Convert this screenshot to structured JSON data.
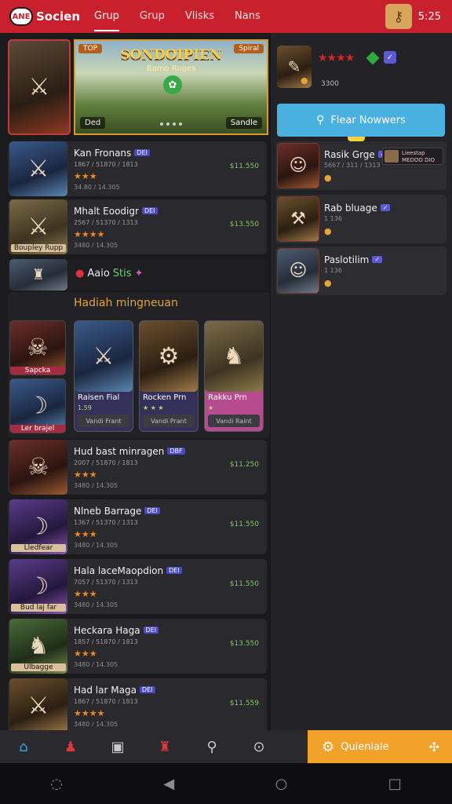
{
  "app": {
    "logo_mark": "ANE",
    "name": "Socien",
    "time": "5:25"
  },
  "tabs": [
    {
      "label": "Grup",
      "active": true
    },
    {
      "label": "Grup",
      "active": false
    },
    {
      "label": "Vlisks",
      "active": false
    },
    {
      "label": "Nans",
      "active": false
    }
  ],
  "banner": {
    "title": "SONDOIPIEN",
    "subtitle": "Bamo Ruges",
    "tag_left": "TOP",
    "tag_right": "Spiral",
    "label": "Ded",
    "button": "Sandle"
  },
  "games": [
    {
      "name": "Kan Fronans",
      "ver": "DEI",
      "meta": "1867 / 51870 / 1813",
      "stars": "★★★",
      "size": "34.80 / 14.305",
      "price": "$11.550",
      "art": "art-a",
      "caption": ""
    },
    {
      "name": "Mhalt Eoodigr",
      "ver": "DEI",
      "meta": "2567 / 51370 / 1313",
      "stars": "★★★★",
      "size": "3480 / 14.305",
      "price": "$13.550",
      "art": "art-c",
      "caption": "Boupley Rupp"
    },
    {
      "name": "Hud bast minragen",
      "ver": "DBF",
      "meta": "2007 / 51870 / 1813",
      "stars": "★★★",
      "size": "3480 / 14.305",
      "price": "$11.250",
      "art": "art-e",
      "caption": ""
    },
    {
      "name": "Nlneb Barrage",
      "ver": "DEI",
      "meta": "1367 / 51370 / 1313",
      "stars": "★★★",
      "size": "3480 / 14.305",
      "price": "$11.550",
      "art": "art-f",
      "caption": "Lledfear"
    },
    {
      "name": "Hala laceMaopdion",
      "ver": "DEI",
      "meta": "7057 / 51370 / 1313",
      "stars": "★★★",
      "size": "3480 / 14.305",
      "price": "$11.550",
      "art": "art-f",
      "caption": "Bud laj far"
    },
    {
      "name": "Heckara Haga",
      "ver": "DEI",
      "meta": "1857 / 51870 / 1813",
      "stars": "★★★",
      "size": "3480 / 14.305",
      "price": "$13.550",
      "art": "art-g",
      "caption": "Ulbagge"
    },
    {
      "name": "Had lar Maga",
      "ver": "DEI",
      "meta": "1867 / 51870 / 1813",
      "stars": "★★★★",
      "size": "3480 / 14.305",
      "price": "$11.559",
      "art": "art-h",
      "caption": ""
    }
  ],
  "online": {
    "label": "Aaio",
    "status": "Stis"
  },
  "section": {
    "title": "Hadiah mingneuan"
  },
  "side_thumbs": [
    {
      "caption": "Sapcka"
    },
    {
      "caption": "Ler brajel"
    }
  ],
  "promos": [
    {
      "title": "Raisen Fial",
      "sub": "1.59",
      "button": "Vandi Frant",
      "style": "purple"
    },
    {
      "title": "Rocken Prn",
      "sub": "★ ★ ★",
      "button": "Vandi Prant",
      "style": "purple"
    },
    {
      "title": "Rakku Prn",
      "sub": "★",
      "button": "Vandi Raint",
      "style": "pink"
    }
  ],
  "right_hero": {
    "stars": "★★★★",
    "count": "3300"
  },
  "follow": {
    "label": "Flear Nowwers"
  },
  "friends": [
    {
      "name": "Rasik Grge",
      "meta": "5667 / 311 / 1313",
      "extra": "Lieestap MEDOO DIO",
      "art": "art-e"
    },
    {
      "name": "Rab bluage",
      "meta": "1 136",
      "extra": "",
      "art": "art-h"
    },
    {
      "name": "Paslotilim",
      "meta": "1 136",
      "extra": "",
      "art": "art-d"
    }
  ],
  "bottom_nav": {
    "cta": "Quieniale"
  }
}
